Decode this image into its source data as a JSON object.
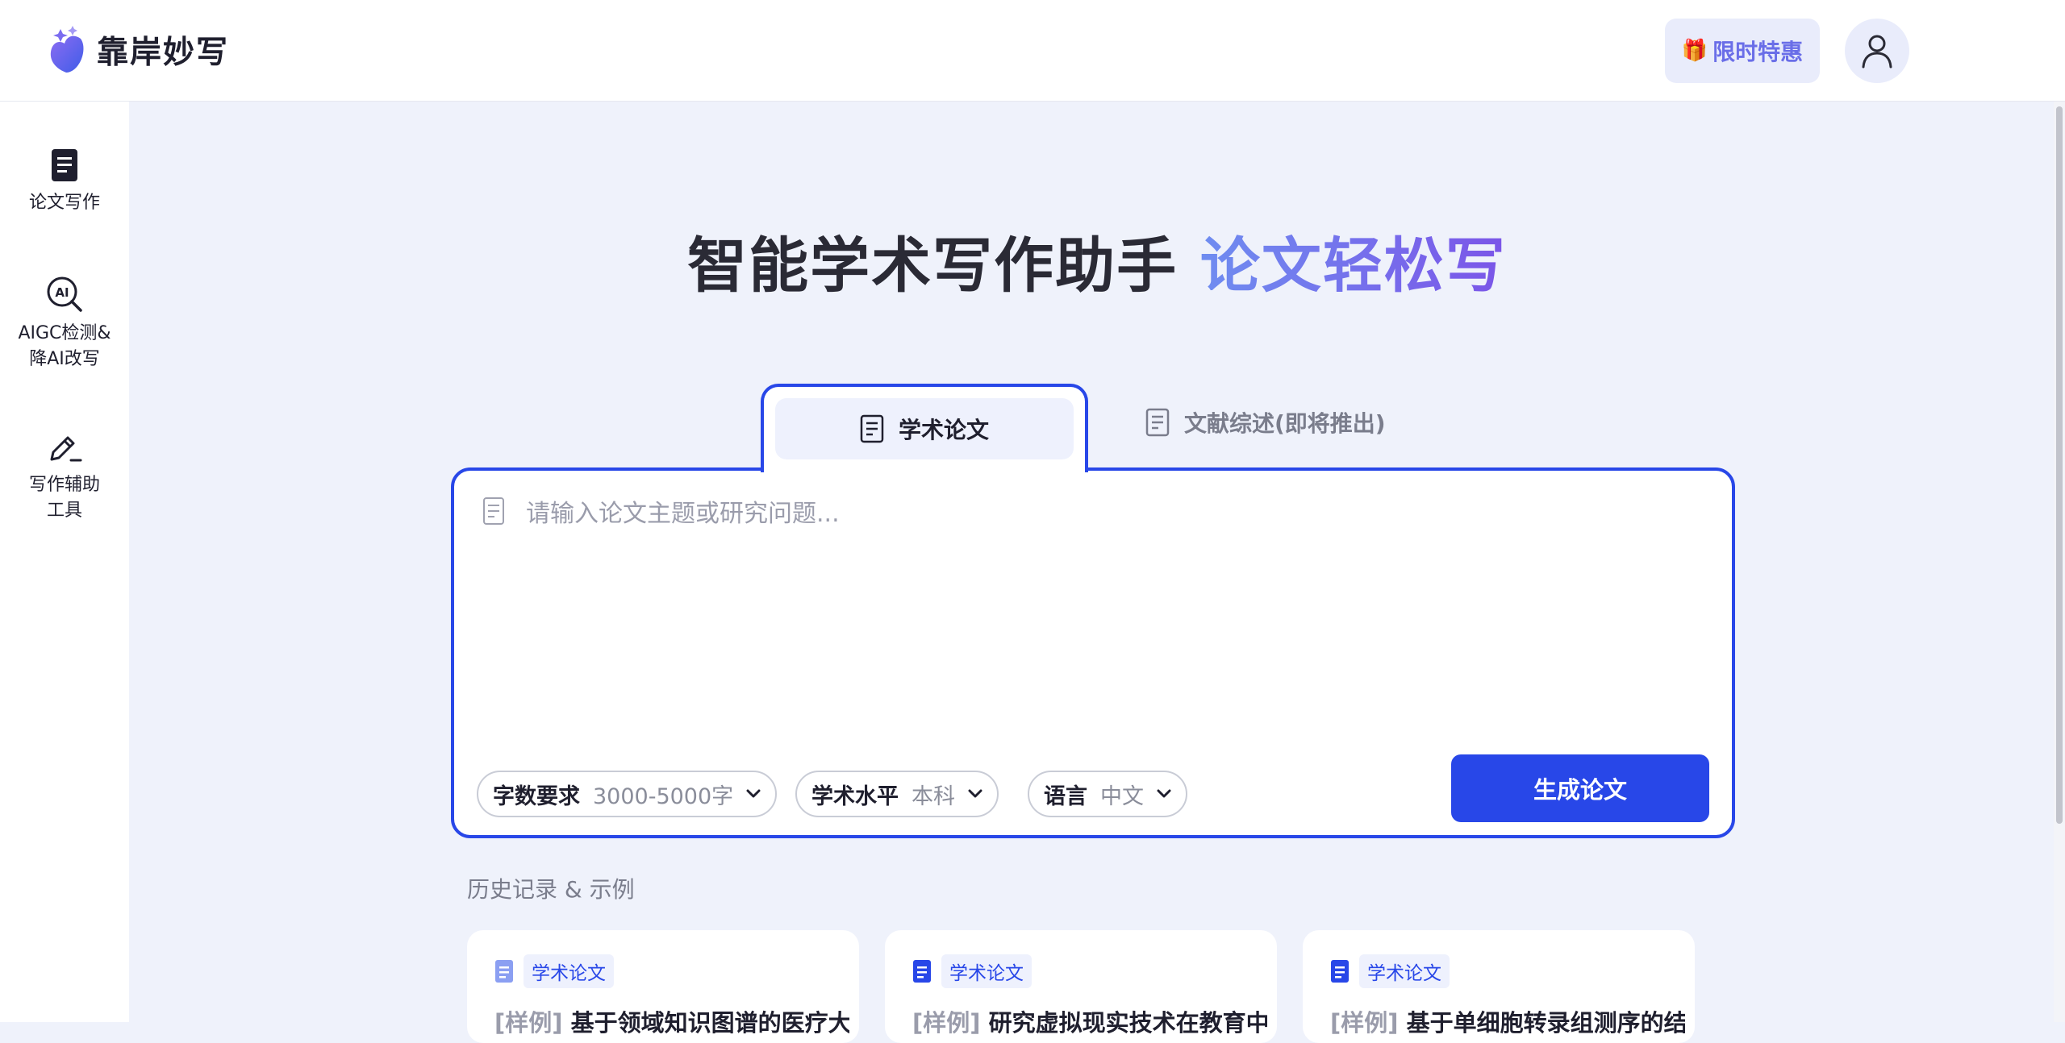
{
  "app": {
    "name": "靠岸妙写"
  },
  "header": {
    "promo_label": "限时特惠"
  },
  "sidebar": {
    "items": [
      {
        "label": "论文写作"
      },
      {
        "label": "AIGC检测&\n降AI改写"
      },
      {
        "label": "写作辅助\n工具"
      }
    ]
  },
  "hero": {
    "title_plain": "智能学术写作助手",
    "title_accent": "论文轻松写"
  },
  "tabs": [
    {
      "label": "学术论文",
      "active": true
    },
    {
      "label": "文献综述(即将推出)",
      "active": false
    }
  ],
  "editor": {
    "placeholder": "请输入论文主题或研究问题..."
  },
  "options": [
    {
      "label": "字数要求",
      "value": "3000-5000字"
    },
    {
      "label": "学术水平",
      "value": "本科"
    },
    {
      "label": "语言",
      "value": "中文"
    }
  ],
  "generate_button": "生成论文",
  "history": {
    "title": "历史记录 & 示例",
    "cards": [
      {
        "tag": "学术论文",
        "prefix": "[样例]",
        "title": " 基于领域知识图谱的医疗大"
      },
      {
        "tag": "学术论文",
        "prefix": "[样例]",
        "title": " 研究虚拟现实技术在教育中"
      },
      {
        "tag": "学术论文",
        "prefix": "[样例]",
        "title": " 基于单细胞转录组测序的结"
      }
    ]
  },
  "colors": {
    "accent": "#2847e8",
    "promo": "#6a6ee8",
    "page_bg": "#eff2fb"
  }
}
